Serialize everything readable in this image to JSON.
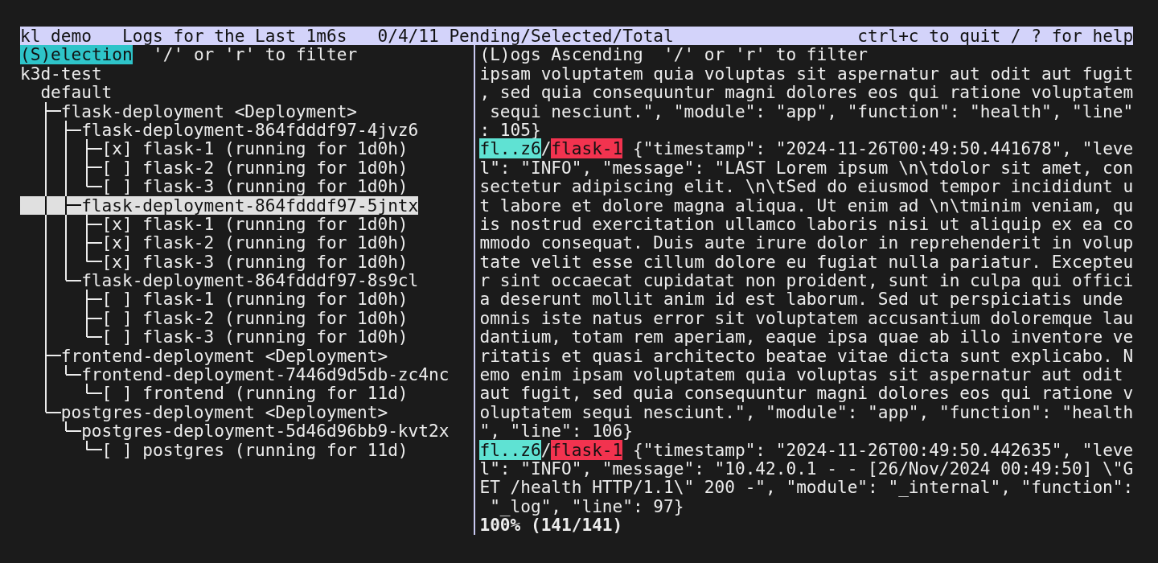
{
  "top_bar": {
    "app": "kl demo",
    "window": "Logs for the Last 1m6s",
    "counts": "0/4/11 Pending/Selected/Total",
    "help": "ctrl+c to quit / ? for help"
  },
  "selection_pane": {
    "title": "(S)election",
    "focused": true,
    "hint": "'/' or 'r' to filter",
    "tree": [
      {
        "label": "k3d-test",
        "selected": false,
        "children": [
          {
            "label": "default",
            "selected": false,
            "children": [
              {
                "label": "flask-deployment <Deployment>",
                "selected": false,
                "children": [
                  {
                    "label": "flask-deployment-864fdddf97-4jvz6",
                    "selected": false,
                    "children": [
                      {
                        "kind": "pod",
                        "checkbox": "[x]",
                        "label": "flask-1 (running for 1d0h)",
                        "selected": false
                      },
                      {
                        "kind": "pod",
                        "checkbox": "[ ]",
                        "label": "flask-2 (running for 1d0h)",
                        "selected": false
                      },
                      {
                        "kind": "pod",
                        "checkbox": "[ ]",
                        "label": "flask-3 (running for 1d0h)",
                        "selected": false
                      }
                    ]
                  },
                  {
                    "label": "flask-deployment-864fdddf97-5jntx",
                    "selected": true,
                    "children": [
                      {
                        "kind": "pod",
                        "checkbox": "[x]",
                        "label": "flask-1 (running for 1d0h)",
                        "selected": false
                      },
                      {
                        "kind": "pod",
                        "checkbox": "[x]",
                        "label": "flask-2 (running for 1d0h)",
                        "selected": false
                      },
                      {
                        "kind": "pod",
                        "checkbox": "[x]",
                        "label": "flask-3 (running for 1d0h)",
                        "selected": false
                      }
                    ]
                  },
                  {
                    "label": "flask-deployment-864fdddf97-8s9cl",
                    "selected": false,
                    "children": [
                      {
                        "kind": "pod",
                        "checkbox": "[ ]",
                        "label": "flask-1 (running for 1d0h)",
                        "selected": false
                      },
                      {
                        "kind": "pod",
                        "checkbox": "[ ]",
                        "label": "flask-2 (running for 1d0h)",
                        "selected": false
                      },
                      {
                        "kind": "pod",
                        "checkbox": "[ ]",
                        "label": "flask-3 (running for 1d0h)",
                        "selected": false
                      }
                    ]
                  }
                ]
              },
              {
                "label": "frontend-deployment <Deployment>",
                "selected": false,
                "children": [
                  {
                    "label": "frontend-deployment-7446d9d5db-zc4nc",
                    "selected": false,
                    "children": [
                      {
                        "kind": "pod",
                        "checkbox": "[ ]",
                        "label": "frontend (running for 11d)",
                        "selected": false
                      }
                    ]
                  }
                ]
              },
              {
                "label": "postgres-deployment <Deployment>",
                "selected": false,
                "children": [
                  {
                    "label": "postgres-deployment-5d46d96bb9-kvt2x",
                    "selected": false,
                    "children": [
                      {
                        "kind": "pod",
                        "checkbox": "[ ]",
                        "label": "postgres (running for 11d)",
                        "selected": false
                      }
                    ]
                  }
                ]
              }
            ]
          }
        ]
      }
    ]
  },
  "logs_pane": {
    "title": "(L)ogs Ascending",
    "focused": false,
    "hint": "'/' or 'r' to filter",
    "entries": [
      {
        "kind": "continuation",
        "lines": [
          "ipsam voluptatem quia voluptas sit aspernatur aut odit aut fugit",
          ", sed quia consequuntur magni dolores eos qui ratione voluptatem",
          " sequi nesciunt.\", \"module\": \"app\", \"function\": \"health\", \"line\"",
          ": 105}"
        ]
      },
      {
        "kind": "log",
        "pod": "fl..z6",
        "separator": "/",
        "container": "flask-1",
        "lines": [
          " {\"timestamp\": \"2024-11-26T00:49:50.441678\", \"leve",
          "l\": \"INFO\", \"message\": \"LAST Lorem ipsum \\n\\tdolor sit amet, con",
          "sectetur adipiscing elit. \\n\\tSed do eiusmod tempor incididunt u",
          "t labore et dolore magna aliqua. Ut enim ad \\n\\tminim veniam, qu",
          "is nostrud exercitation ullamco laboris nisi ut aliquip ex ea co",
          "mmodo consequat. Duis aute irure dolor in reprehenderit in volup",
          "tate velit esse cillum dolore eu fugiat nulla pariatur. Excepteu",
          "r sint occaecat cupidatat non proident, sunt in culpa qui offici",
          "a deserunt mollit anim id est laborum. Sed ut perspiciatis unde",
          "omnis iste natus error sit voluptatem accusantium doloremque lau",
          "dantium, totam rem aperiam, eaque ipsa quae ab illo inventore ve",
          "ritatis et quasi architecto beatae vitae dicta sunt explicabo. N",
          "emo enim ipsam voluptatem quia voluptas sit aspernatur aut odit",
          "aut fugit, sed quia consequuntur magni dolores eos qui ratione v",
          "oluptatem sequi nesciunt.\", \"module\": \"app\", \"function\": \"health",
          "\", \"line\": 106}"
        ]
      },
      {
        "kind": "log",
        "pod": "fl..z6",
        "separator": "/",
        "container": "flask-1",
        "lines": [
          " {\"timestamp\": \"2024-11-26T00:49:50.442635\", \"leve",
          "l\": \"INFO\", \"message\": \"10.42.0.1 - - [26/Nov/2024 00:49:50] \\\"G",
          "ET /health HTTP/1.1\\\" 200 -\", \"module\": \"_internal\", \"function\":",
          " \"_log\", \"line\": 97}"
        ]
      }
    ],
    "status": "100% (141/141)"
  }
}
